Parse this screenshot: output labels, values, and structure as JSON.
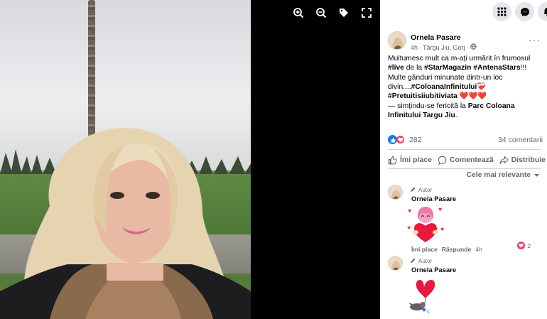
{
  "viewer": {
    "icons": [
      "zoom-in-icon",
      "zoom-out-icon",
      "tag-icon",
      "fullscreen-icon"
    ]
  },
  "topbar": {
    "icons": [
      "menu-grid-icon",
      "messenger-icon",
      "notifications-icon"
    ]
  },
  "post": {
    "author": "Ornela Pasare",
    "time": "4h",
    "location": "Târgu Jiu, Gorj",
    "separator": "·",
    "more": "···",
    "text_1": "Multumesc mult ca m-ați urmărit în frumosul",
    "tag_live": "#live",
    "text_2": "de la",
    "tag_starmagazin": "#StarMagazin",
    "tag_antenastars": "#AntenaStars",
    "text_3": "!!! Multe gânduri minunate dintr-un loc divin....",
    "tag_coloana": "#ColoanaInfinitului",
    "emoji_1": "❤️‍🩹",
    "tag_pretuiti": "#Pretuitisiiubitiviata",
    "emoji_hearts": "❤️❤️❤️",
    "feeling_prefix": "— simțindu-se fericită la",
    "feeling_place": "Parc Coloana Infinitului Targu Jiu",
    "feeling_end": "."
  },
  "reactions": {
    "count": "282",
    "comments": "34 comentarii"
  },
  "actions": {
    "like": "Îmi place",
    "comment": "Comentează",
    "share": "Distribuie"
  },
  "sort": {
    "label": "Cele mai relevante"
  },
  "comments": [
    {
      "badge": "Autor",
      "name": "Ornela Pasare",
      "like": "Îmi place",
      "reply": "Răspunde",
      "time": "4h",
      "reaction_count": "2"
    },
    {
      "badge": "Autor",
      "name": "Ornela Pasare"
    }
  ],
  "colors": {
    "like_blue": "#1877f2",
    "heart_red": "#f33e58",
    "text": "#050505",
    "muted": "#65676b"
  }
}
